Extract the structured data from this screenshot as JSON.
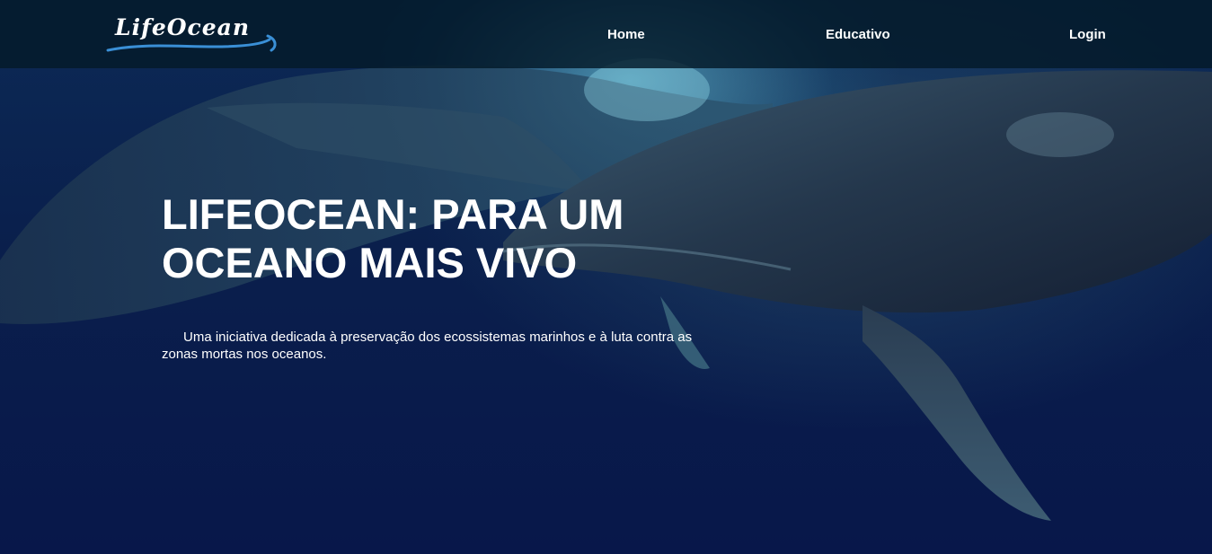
{
  "brand": {
    "name": "LifeOcean"
  },
  "nav": {
    "items": [
      {
        "label": "Home"
      },
      {
        "label": "Educativo"
      },
      {
        "label": "Login"
      }
    ]
  },
  "hero": {
    "title": "LIFEOCEAN: PARA UM OCEANO MAIS VIVO",
    "subtitle": "Uma iniciativa dedicada à preservação dos ecossistemas marinhos e à luta contra as zonas mortas nos oceanos.",
    "background_image": "humpback-whales-underwater"
  },
  "colors": {
    "navbar_bg": "#041a28",
    "ocean_deep": "#08174a",
    "logo_wave": "#3a8fd6",
    "text": "#ffffff"
  }
}
